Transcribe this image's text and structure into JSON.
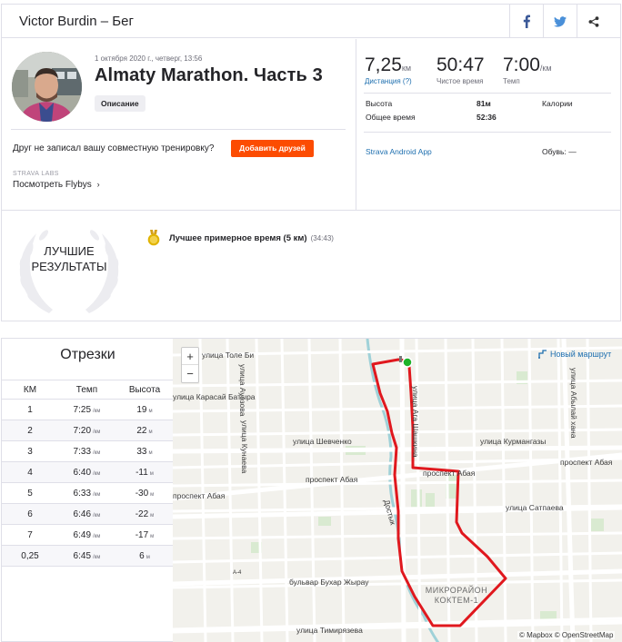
{
  "header": {
    "title": "Victor Burdin – Бег",
    "share_icons": [
      "facebook-icon",
      "twitter-icon",
      "share-icon"
    ]
  },
  "activity": {
    "date": "1 октября 2020 г., четверг, 13:56",
    "title": "Almaty Marathon. Часть 3",
    "description_button": "Описание",
    "friend_prompt": "Друг не записал вашу совместную тренировку?",
    "add_friends_button": "Добавить друзей",
    "labs_label": "STRAVA LABS",
    "flybys_link": "Посмотреть Flybys"
  },
  "stats": {
    "distance": {
      "value": "7,25",
      "unit": "км",
      "label": "Дистанция (?)"
    },
    "moving_time": {
      "value": "50:47",
      "label": "Чистое время"
    },
    "pace": {
      "value": "7:00",
      "unit": "/км",
      "label": "Темп"
    },
    "elevation": {
      "label": "Высота",
      "value": "81м"
    },
    "calories": {
      "label": "Калории"
    },
    "elapsed": {
      "label": "Общее время",
      "value": "52:36"
    },
    "device": "Strava Android App",
    "shoes": "Обувь: —"
  },
  "achievements": {
    "badge_text": "ЛУЧШИЕ РЕЗУЛЬТАТЫ",
    "items": [
      {
        "text": "Лучшее примерное время (5 км)",
        "time": "(34:43)",
        "icon": "medal-icon"
      }
    ]
  },
  "splits": {
    "title": "Отрезки",
    "columns": [
      "КМ",
      "Темп",
      "Высота"
    ],
    "rows": [
      {
        "km": "1",
        "pace": "7:25",
        "pace_unit": "/км",
        "elev": "19",
        "elev_unit": "м"
      },
      {
        "km": "2",
        "pace": "7:20",
        "pace_unit": "/км",
        "elev": "22",
        "elev_unit": "м"
      },
      {
        "km": "3",
        "pace": "7:33",
        "pace_unit": "/км",
        "elev": "33",
        "elev_unit": "м"
      },
      {
        "km": "4",
        "pace": "6:40",
        "pace_unit": "/км",
        "elev": "-11",
        "elev_unit": "м"
      },
      {
        "km": "5",
        "pace": "6:33",
        "pace_unit": "/км",
        "elev": "-30",
        "elev_unit": "м"
      },
      {
        "km": "6",
        "pace": "6:46",
        "pace_unit": "/км",
        "elev": "-22",
        "elev_unit": "м"
      },
      {
        "km": "7",
        "pace": "6:49",
        "pace_unit": "/км",
        "elev": "-17",
        "elev_unit": "м"
      },
      {
        "km": "0,25",
        "pace": "6:45",
        "pace_unit": "/км",
        "elev": "6",
        "elev_unit": "м"
      }
    ]
  },
  "map": {
    "zoom_in": "+",
    "zoom_out": "−",
    "new_route": "Новый маршрут",
    "attribution": "© Mapbox © OpenStreetMap",
    "district": [
      "МИКРОРАЙОН",
      "КОКТЕМ-1"
    ],
    "streets": {
      "tole_bi": "улица Толе Би",
      "auezova": "улица Ауэзова",
      "karasay": "улица Карасай Батыра",
      "kunaeva": "улица Кунаева",
      "shevchenko": "улица Шевченко",
      "kurmangazy": "улица Курмангазы",
      "abaya_left": "проспект Абая",
      "abaya_mid": "проспект Абая",
      "abaya_right": "проспект Абая",
      "abaya_right2": "проспект Абая",
      "satpaeva": "улица Сатпаева",
      "buhar": "бульвар Бухар Жырау",
      "timiryazeva": "улица Тимирязева",
      "shashkina": "улица Ага Шашкина",
      "dostyk": "Достык",
      "abylai": "улица Абылай хана",
      "road_a4": "А-4"
    },
    "route_color": "#e0181e",
    "start_color": "#1db32a"
  }
}
